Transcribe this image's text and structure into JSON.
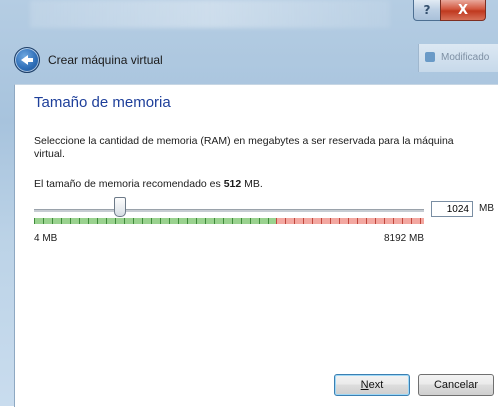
{
  "window": {
    "caption_help": "?",
    "caption_close": "X",
    "background_hint": "Modificado"
  },
  "header": {
    "title": "Crear máquina virtual"
  },
  "page": {
    "title": "Tamaño de memoria",
    "description": "Seleccione la cantidad de memoria (RAM) en megabytes a ser reservada para la máquina virtual.",
    "recommended_prefix": "El tamaño de memoria recomendado es ",
    "recommended_value": "512",
    "recommended_suffix": " MB."
  },
  "memory": {
    "value": "1024",
    "unit": "MB",
    "min_label": "4 MB",
    "max_label": "8192 MB",
    "min": 4,
    "max": 8192,
    "current": 1024,
    "green_fraction": 0.62
  },
  "footer": {
    "next_label": "Next",
    "cancel_label": "Cancelar"
  },
  "colors": {
    "title_blue": "#1e3f9a",
    "safe_green": "#9ad28f",
    "danger_red": "#f3a8a1"
  }
}
